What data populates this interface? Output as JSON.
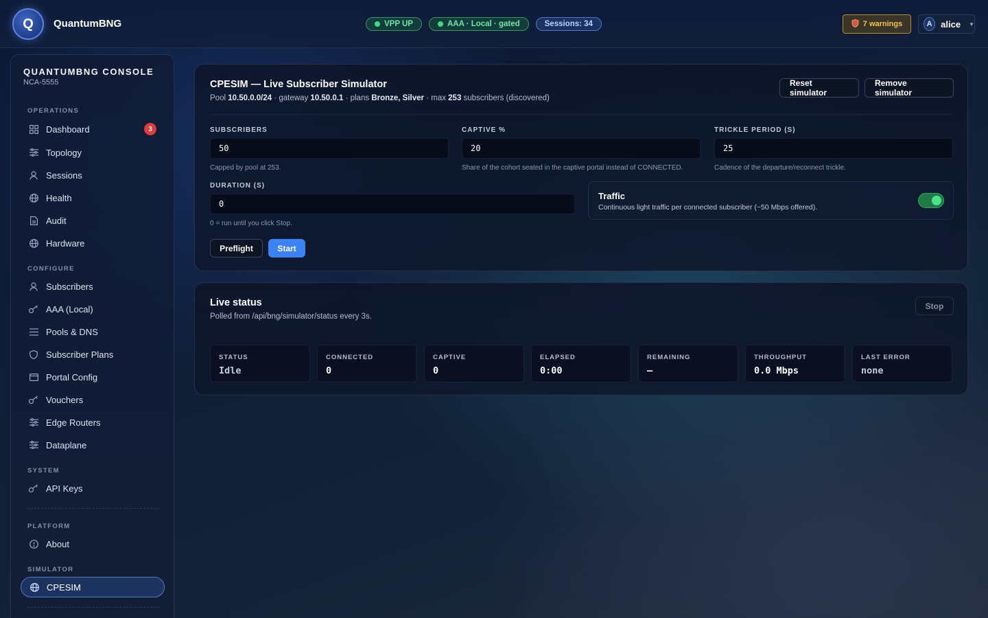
{
  "header": {
    "logo_letter": "Q",
    "brand": "QuantumBNG",
    "pills": [
      "VPP UP",
      "AAA · Local · gated",
      "Sessions: 34"
    ],
    "warnings": "7 warnings",
    "user_initial": "A",
    "user_name": "alice"
  },
  "sidebar": {
    "title": "QUANTUMBNG CONSOLE",
    "subtitle": "NCA-5555",
    "sections": {
      "operations": "OPERATIONS",
      "configure": "CONFIGURE",
      "system": "SYSTEM",
      "platform": "PLATFORM",
      "simulator": "SIMULATOR"
    },
    "items": {
      "dashboard": "Dashboard",
      "dashboard_badge": "3",
      "topology": "Topology",
      "sessions": "Sessions",
      "health": "Health",
      "audit": "Audit",
      "hardware": "Hardware",
      "subscribers": "Subscribers",
      "aaa": "AAA (Local)",
      "pools": "Pools & DNS",
      "plans": "Subscriber Plans",
      "portal": "Portal Config",
      "vouchers": "Vouchers",
      "edge": "Edge Routers",
      "dataplane": "Dataplane",
      "apikeys": "API Keys",
      "about": "About",
      "cpesim": "CPESIM"
    }
  },
  "simulator": {
    "title": "CPESIM — Live Subscriber Simulator",
    "sub": {
      "pool_prefix": "Pool ",
      "pool": "10.50.0.0/24",
      "gw_prefix": " · gateway ",
      "gateway": "10.50.0.1",
      "plans_prefix": " · plans ",
      "plans": "Bronze, Silver",
      "max_prefix": " · max ",
      "max": "253",
      "max_suffix": " subscribers (discovered)"
    },
    "reset_button": "Reset simulator",
    "remove_button": "Remove simulator",
    "fields": {
      "subscribers_label": "SUBSCRIBERS",
      "subscribers_value": "50",
      "subscribers_hint": "Capped by pool at 253.",
      "captive_label": "CAPTIVE %",
      "captive_value": "20",
      "captive_hint": "Share of the cohort seated in the captive portal instead of CONNECTED.",
      "trickle_label": "TRICKLE PERIOD (S)",
      "trickle_value": "25",
      "trickle_hint": "Cadence of the departure/reconnect trickle.",
      "duration_label": "DURATION (S)",
      "duration_value": "0",
      "duration_hint": "0 = run until you click Stop."
    },
    "traffic": {
      "title": "Traffic",
      "desc": "Continuous light traffic per connected subscriber (~50 Mbps offered).",
      "enabled": true
    },
    "preflight_button": "Preflight",
    "start_button": "Start"
  },
  "live_status": {
    "title": "Live status",
    "sub": "Polled from /api/bng/simulator/status every 3s.",
    "stop_button": "Stop",
    "stats": [
      {
        "label": "STATUS",
        "value": "Idle"
      },
      {
        "label": "CONNECTED",
        "value": "0"
      },
      {
        "label": "CAPTIVE",
        "value": "0"
      },
      {
        "label": "ELAPSED",
        "value": "0:00"
      },
      {
        "label": "REMAINING",
        "value": "—"
      },
      {
        "label": "THROUGHPUT",
        "value": "0.0 Mbps"
      },
      {
        "label": "LAST ERROR",
        "value": "none"
      }
    ]
  }
}
